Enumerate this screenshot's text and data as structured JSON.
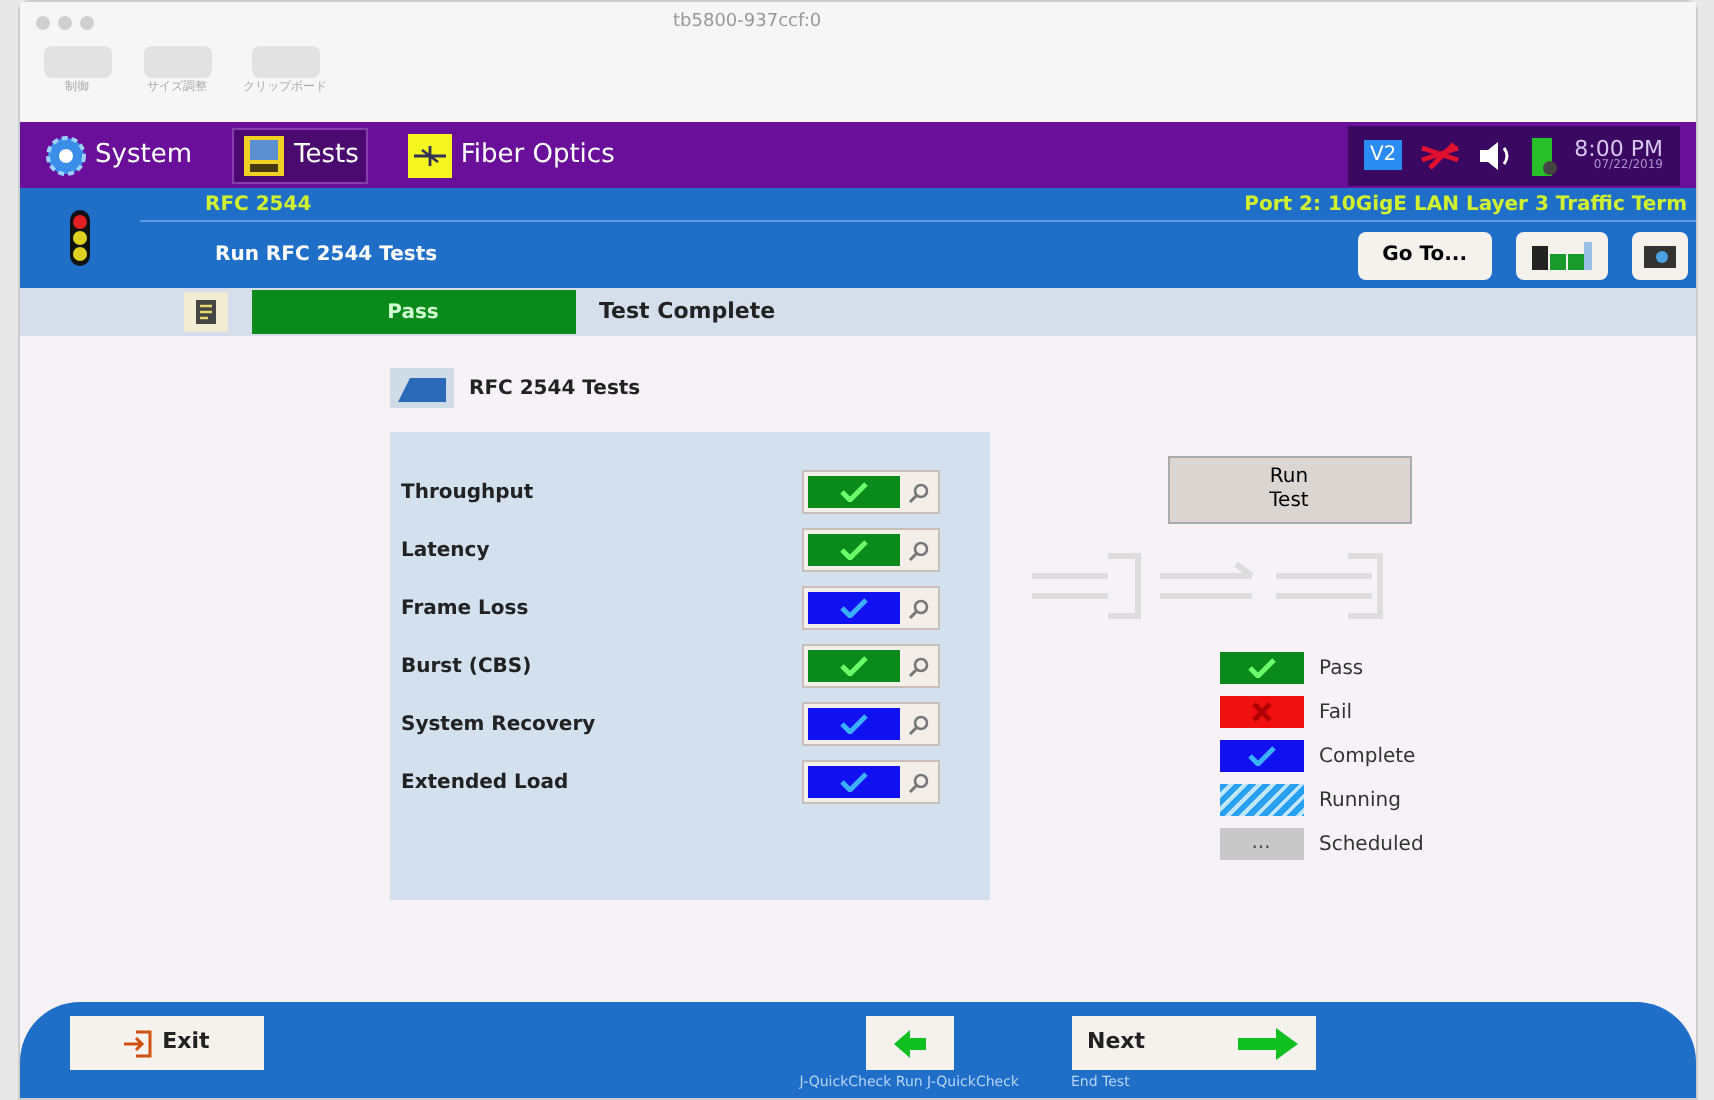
{
  "window": {
    "title": "tb5800-937ccf:0"
  },
  "toolbar": [
    {
      "label": "制御"
    },
    {
      "label": "サイズ調整"
    },
    {
      "label": "クリップボード"
    }
  ],
  "menu_bar": {
    "tabs": [
      {
        "label": "System",
        "selected": false
      },
      {
        "label": "Tests",
        "selected": true
      },
      {
        "label": "Fiber Optics",
        "selected": false
      }
    ],
    "status_badge": "V2",
    "time": "8:00 PM",
    "date": "07/22/2019"
  },
  "header": {
    "test_name": "RFC 2544",
    "subtitle": "Run RFC 2544 Tests",
    "port": "Port 2: 10GigE LAN Layer 3 Traffic Term",
    "goto_button": "Go To..."
  },
  "status_bar": {
    "result": "Pass",
    "message": "Test Complete"
  },
  "panel": {
    "title": "RFC 2544 Tests",
    "tests": [
      {
        "name": "Throughput",
        "kind": "pass"
      },
      {
        "name": "Latency",
        "kind": "pass"
      },
      {
        "name": "Frame Loss",
        "kind": "complete"
      },
      {
        "name": "Burst (CBS)",
        "kind": "pass"
      },
      {
        "name": "System Recovery",
        "kind": "complete"
      },
      {
        "name": "Extended Load",
        "kind": "complete"
      }
    ]
  },
  "run_button": "Run\nTest",
  "legend": [
    {
      "label": "Pass",
      "kind": "pass"
    },
    {
      "label": "Fail",
      "kind": "fail"
    },
    {
      "label": "Complete",
      "kind": "complete"
    },
    {
      "label": "Running",
      "kind": "running"
    },
    {
      "label": "Scheduled",
      "kind": "scheduled",
      "text": "..."
    }
  ],
  "footer": {
    "exit_button": "Exit",
    "back_caption": "J-QuickCheck Run J-QuickCheck",
    "next_button": "Next",
    "next_caption": "End Test"
  }
}
